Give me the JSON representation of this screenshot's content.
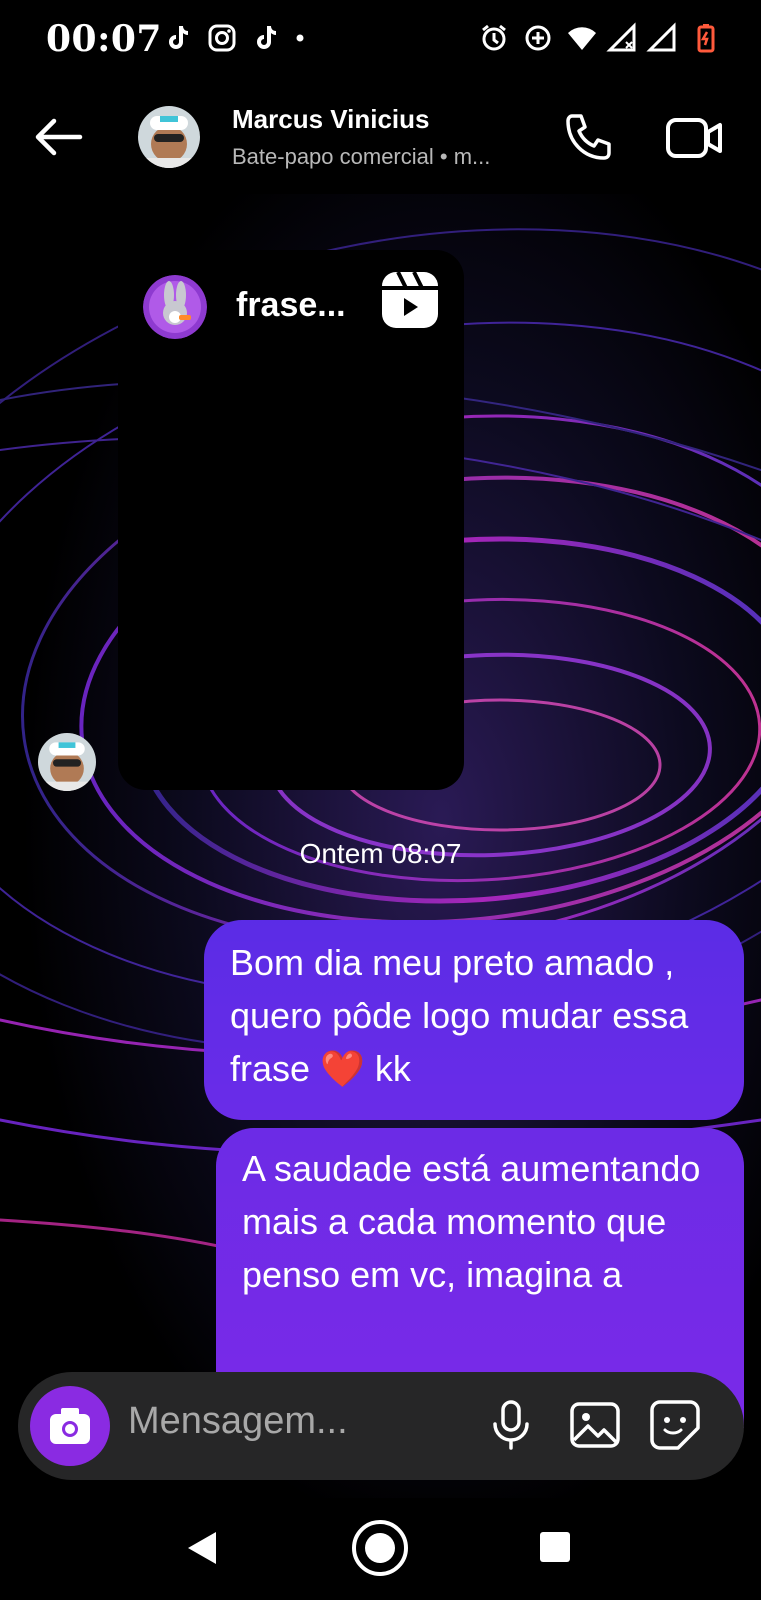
{
  "status_bar": {
    "time": "00:07",
    "left_icons": [
      "tiktok-icon",
      "instagram-icon",
      "tiktok-icon",
      "notification-dot-icon"
    ],
    "right_icons": [
      "alarm-icon",
      "data-saver-icon",
      "wifi-icon",
      "signal-icon",
      "signal-icon",
      "battery-charging-icon"
    ]
  },
  "header": {
    "contact_name": "Marcus Vinicius",
    "subtitle": "Bate-papo comercial • m..."
  },
  "conversation": {
    "shared_reel": {
      "title": "frase..."
    },
    "timestamp": "Ontem 08:07",
    "messages": [
      {
        "sender": "me",
        "text": "Bom dia meu preto amado , quero pôde logo mudar essa frase ",
        "emoji": "❤️",
        "suffix": " kk"
      },
      {
        "sender": "me",
        "text": "A saudade está aumentando mais a cada momento que penso em vc, imagina a"
      }
    ]
  },
  "composer": {
    "placeholder": "Mensagem..."
  },
  "colors": {
    "bubble_top": "#5b2ce6",
    "bubble_bottom": "#7a2ae8",
    "camera_button": "#8a2be2",
    "composer_bg": "#262627"
  }
}
